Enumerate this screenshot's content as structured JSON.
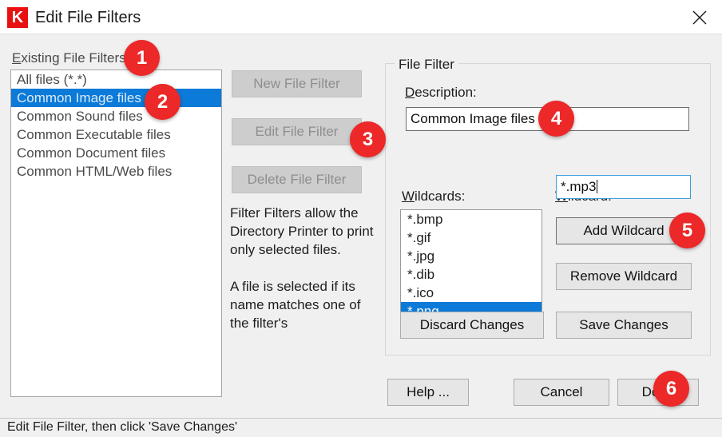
{
  "window": {
    "title": "Edit File Filters",
    "icon": "K",
    "close_icon": "close-icon"
  },
  "left_panel": {
    "list_label": "Existing File Filters:",
    "list_label_accel": "E",
    "filters": [
      {
        "label": "All files (*.*)",
        "selected": false
      },
      {
        "label": "Common Image files",
        "selected": true
      },
      {
        "label": "Common Sound files",
        "selected": false
      },
      {
        "label": "Common Executable files",
        "selected": false
      },
      {
        "label": "Common Document files",
        "selected": false
      },
      {
        "label": "Common HTML/Web files",
        "selected": false
      }
    ]
  },
  "middle_panel": {
    "buttons": [
      {
        "label": "New File Filter",
        "enabled": false
      },
      {
        "label": "Edit File Filter",
        "enabled": false
      },
      {
        "label": "Delete File Filter",
        "enabled": false
      }
    ],
    "help_paragraph_1": "Filter Filters allow the Directory Printer to print only selected files.",
    "help_paragraph_2": "A file is selected if its name matches one of the filter's"
  },
  "file_filter_group": {
    "title": "File Filter",
    "description_label": "Description:",
    "description_accel": "D",
    "description_value": "Common Image files",
    "wildcards_label": "Wildcards:",
    "wildcards_accel": "W",
    "wildcards": [
      {
        "label": "*.bmp",
        "selected": false
      },
      {
        "label": "*.gif",
        "selected": false
      },
      {
        "label": "*.jpg",
        "selected": false
      },
      {
        "label": "*.dib",
        "selected": false
      },
      {
        "label": "*.ico",
        "selected": false
      },
      {
        "label": "*.png",
        "selected": true
      }
    ],
    "wildcard_input_label": "Wildcard:",
    "wildcard_input_accel": "W",
    "wildcard_input_value": "*.mp3",
    "add_wildcard_label": "Add Wildcard",
    "remove_wildcard_label": "Remove Wildcard",
    "discard_changes_label": "Discard Changes",
    "save_changes_label": "Save Changes"
  },
  "dialog_buttons": {
    "help_label": "Help ...",
    "cancel_label": "Cancel",
    "done_label": "Done"
  },
  "status_bar": {
    "message": "Edit File Filter, then click 'Save Changes'"
  },
  "badges": [
    {
      "number": "1"
    },
    {
      "number": "2"
    },
    {
      "number": "3"
    },
    {
      "number": "4"
    },
    {
      "number": "5"
    },
    {
      "number": "6"
    }
  ],
  "colors": {
    "accent_red": "#ec2828",
    "selection_blue": "#0b7ad8",
    "window_bg": "#f0f0f0"
  }
}
